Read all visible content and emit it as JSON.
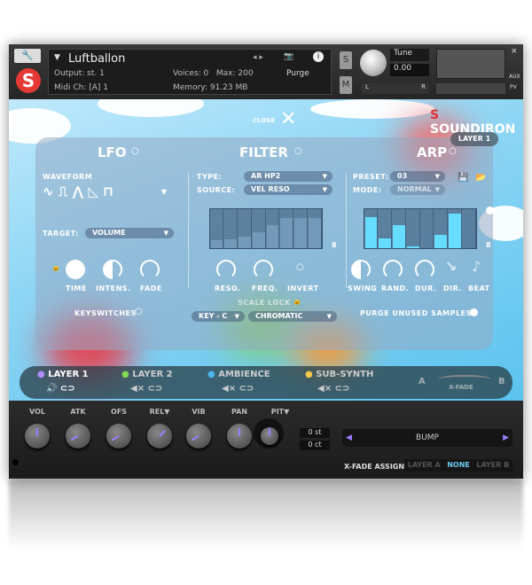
{
  "header": {
    "instrument_name": "Luftballon",
    "output_label": "Output:",
    "output_value": "st. 1",
    "midi_label": "Midi Ch:",
    "midi_value": "[A] 1",
    "voices_label": "Voices:",
    "voices_value": "0",
    "max_label": "Max:",
    "max_value": "200",
    "memory_label": "Memory:",
    "memory_value": "91.23 MB",
    "purge_label": "Purge",
    "solo": "S",
    "mute": "M",
    "tune_label": "Tune",
    "tune_value": "0.00",
    "pan_l": "L",
    "pan_r": "R",
    "aux": "AUX",
    "pv": "PV"
  },
  "brand": {
    "logo": "SOUNDIRON",
    "close_label": "CLOSE",
    "layer_badge": "LAYER 1"
  },
  "lfo": {
    "title": "LFO",
    "waveform_label": "WAVEFORM",
    "target_label": "TARGET:",
    "target_value": "VOLUME",
    "knobs": [
      "TIME",
      "INTENS.",
      "FADE"
    ],
    "keyswitches": "KEYSWITCHES"
  },
  "filter": {
    "title": "FILTER",
    "type_label": "TYPE:",
    "type_value": "AR HP2",
    "source_label": "SOURCE:",
    "source_value": "VEL RESO",
    "steps": [
      0.2,
      0.22,
      0.3,
      0.4,
      0.6,
      0.78,
      0.78,
      0.78
    ],
    "step_count": "8",
    "knobs": [
      "RESO.",
      "FREQ.",
      "INVERT"
    ],
    "scale_lock": "SCALE LOCK",
    "key_value": "KEY - C",
    "scale_value": "CHROMATIC"
  },
  "arp": {
    "title": "ARP",
    "preset_label": "PRESET:",
    "preset_value": "03",
    "mode_label": "MODE:",
    "mode_value": "NORMAL",
    "steps": [
      0.8,
      0.25,
      0.6,
      0.05,
      0,
      0.35,
      0.88,
      0
    ],
    "step_count": "8",
    "knobs": [
      "SWING",
      "RAND.",
      "DUR.",
      "DIR.",
      "BEAT"
    ],
    "purge": "PURGE UNUSED SAMPLES"
  },
  "layers": [
    {
      "name": "LAYER 1",
      "color": "#b38cff"
    },
    {
      "name": "LAYER 2",
      "color": "#7ed957"
    },
    {
      "name": "AMBIENCE",
      "color": "#4fb6f0"
    },
    {
      "name": "SUB-SYNTH",
      "color": "#f5c84a"
    }
  ],
  "xfade": {
    "a": "A",
    "b": "B",
    "label": "X-FADE"
  },
  "bottom": {
    "knobs": [
      "VOL",
      "ATK",
      "OFS",
      "REL▼",
      "VIB",
      "PAN",
      "PIT▼"
    ],
    "semitones": "0 st",
    "cents": "0 ct",
    "preset": "BUMP",
    "xfade_assign": "X-FADE ASSIGN",
    "options": [
      "LAYER A",
      "NONE",
      "LAYER B"
    ],
    "accent": "#9b7cff"
  }
}
